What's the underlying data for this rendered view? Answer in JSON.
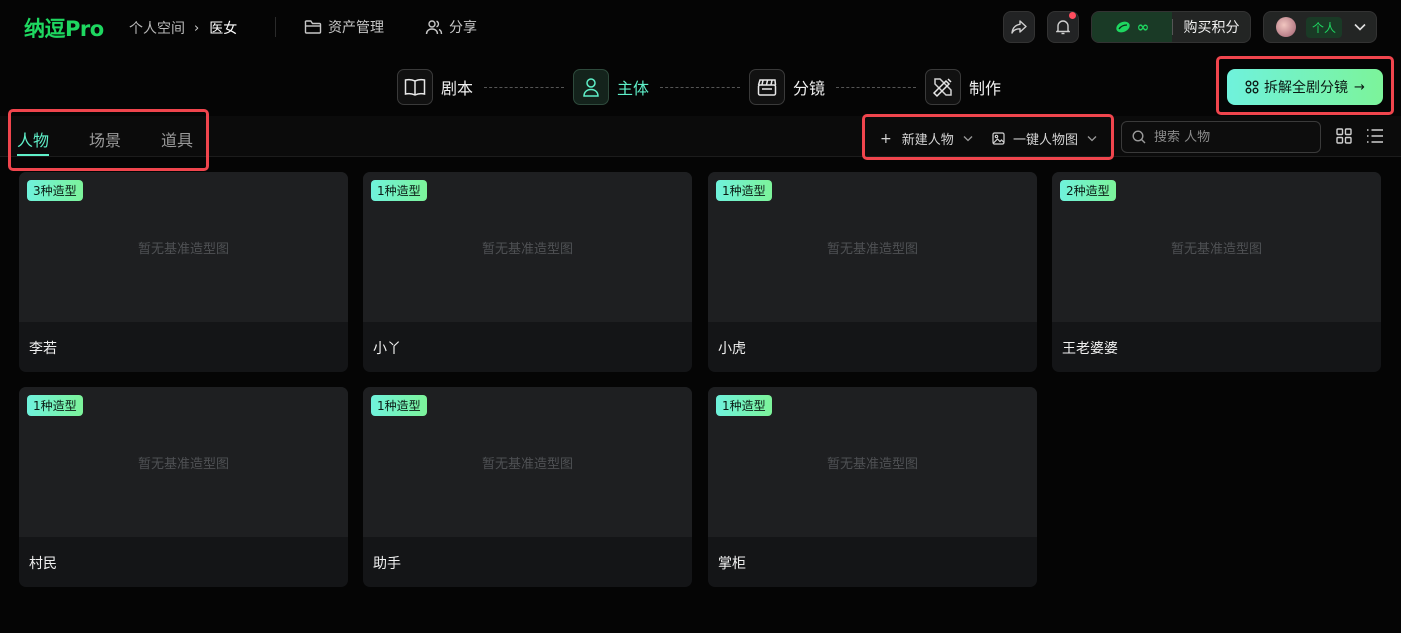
{
  "app": {
    "logo": "纳逗Pro",
    "breadcrumb": {
      "parent": "个人空间",
      "separator": "›",
      "current": "医女"
    },
    "nav": {
      "assets": "资产管理",
      "share": "分享"
    },
    "points": {
      "value": "∞",
      "buy": "购买积分"
    },
    "user": {
      "badge": "个人"
    }
  },
  "steps": [
    {
      "label": "剧本",
      "icon": "book-icon"
    },
    {
      "label": "主体",
      "icon": "person-icon",
      "active": true
    },
    {
      "label": "分镜",
      "icon": "clapperboard-icon"
    },
    {
      "label": "制作",
      "icon": "tools-icon"
    }
  ],
  "split_button": {
    "label": "拆解全剧分镜",
    "arrow": "→"
  },
  "tabs": [
    {
      "label": "人物",
      "active": true
    },
    {
      "label": "场景"
    },
    {
      "label": "道具"
    }
  ],
  "toolbar": {
    "new_label": "新建人物",
    "new_plus": "+",
    "generate_label": "一键人物图",
    "search_placeholder": "搜索 人物"
  },
  "cards": [
    {
      "badge": "3种造型",
      "empty": "暂无基准造型图",
      "name": "李若"
    },
    {
      "badge": "1种造型",
      "empty": "暂无基准造型图",
      "name": "小丫"
    },
    {
      "badge": "1种造型",
      "empty": "暂无基准造型图",
      "name": "小虎"
    },
    {
      "badge": "2种造型",
      "empty": "暂无基准造型图",
      "name": "王老婆婆"
    },
    {
      "badge": "1种造型",
      "empty": "暂无基准造型图",
      "name": "村民"
    },
    {
      "badge": "1种造型",
      "empty": "暂无基准造型图",
      "name": "助手"
    },
    {
      "badge": "1种造型",
      "empty": "暂无基准造型图",
      "name": "掌柜"
    }
  ],
  "colors": {
    "brand": "#1ed760",
    "accent": "#5ff0c9",
    "highlight": "#f0454d",
    "notify": "#ff4d5e"
  }
}
